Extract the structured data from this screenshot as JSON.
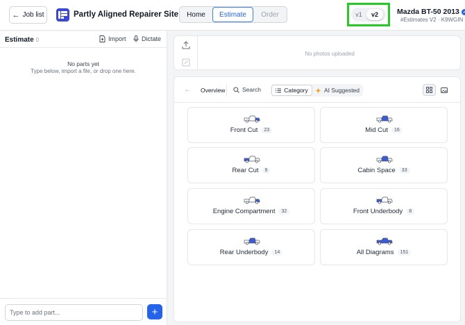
{
  "header": {
    "back_label": "Job list",
    "site_title": "Partly Aligned Repairer Site",
    "nav": [
      {
        "label": "Home"
      },
      {
        "label": "Estimate"
      },
      {
        "label": "Order"
      }
    ],
    "version": {
      "v1": "v1",
      "v2": "v2",
      "selected": "v2"
    },
    "vehicle_name": "Mazda BT-50 2013",
    "vehicle_sub": "#Estimates V2 · K9WGIN"
  },
  "estimate_panel": {
    "title": "Estimate",
    "count": "0",
    "import_label": "Import",
    "dictate_label": "Dictate",
    "empty_title": "No parts yet",
    "empty_sub": "Type below, import a file, or drop one here.",
    "input_placeholder": "Type to add part...",
    "add_symbol": "+"
  },
  "photos": {
    "empty_text": "No photos uploaded"
  },
  "catalog": {
    "toolbar": {
      "overview_label": "Overview",
      "search_label": "Search",
      "category_label": "Category",
      "ai_label": "AI Suggested"
    },
    "categories": [
      {
        "label": "Front Cut",
        "count": "23"
      },
      {
        "label": "Mid Cut",
        "count": "16"
      },
      {
        "label": "Rear Cut",
        "count": "9"
      },
      {
        "label": "Cabin Space",
        "count": "33"
      },
      {
        "label": "Engine Compartment",
        "count": "32"
      },
      {
        "label": "Front Underbody",
        "count": "8"
      },
      {
        "label": "Rear Underbody",
        "count": "14"
      },
      {
        "label": "All Diagrams",
        "count": "151"
      }
    ]
  },
  "colors": {
    "accent": "#2563eb",
    "logo": "#3b47d6",
    "highlight_border": "#22cc22"
  }
}
